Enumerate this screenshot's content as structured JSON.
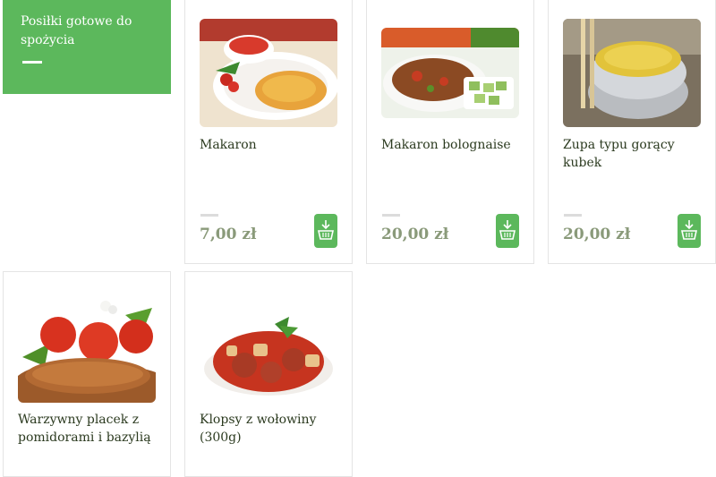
{
  "category": {
    "title": "Posiłki gotowe do spożycia"
  },
  "products": [
    {
      "name": "Makaron",
      "price": "7,00 zł",
      "icon": "cart-add-icon"
    },
    {
      "name": "Makaron bolognaise",
      "price": "20,00 zł",
      "icon": "cart-add-icon"
    },
    {
      "name": "Zupa typu gorący kubek",
      "price": "20,00 zł",
      "icon": "cart-add-icon"
    },
    {
      "name": "Warzywny placek z pomidorami i bazylią"
    },
    {
      "name": "Klopsy z wołowiny (300g)"
    }
  ],
  "colors": {
    "accent": "#5cb85c",
    "price_text": "#8a9a7a",
    "title_text": "#2b3a1f"
  }
}
